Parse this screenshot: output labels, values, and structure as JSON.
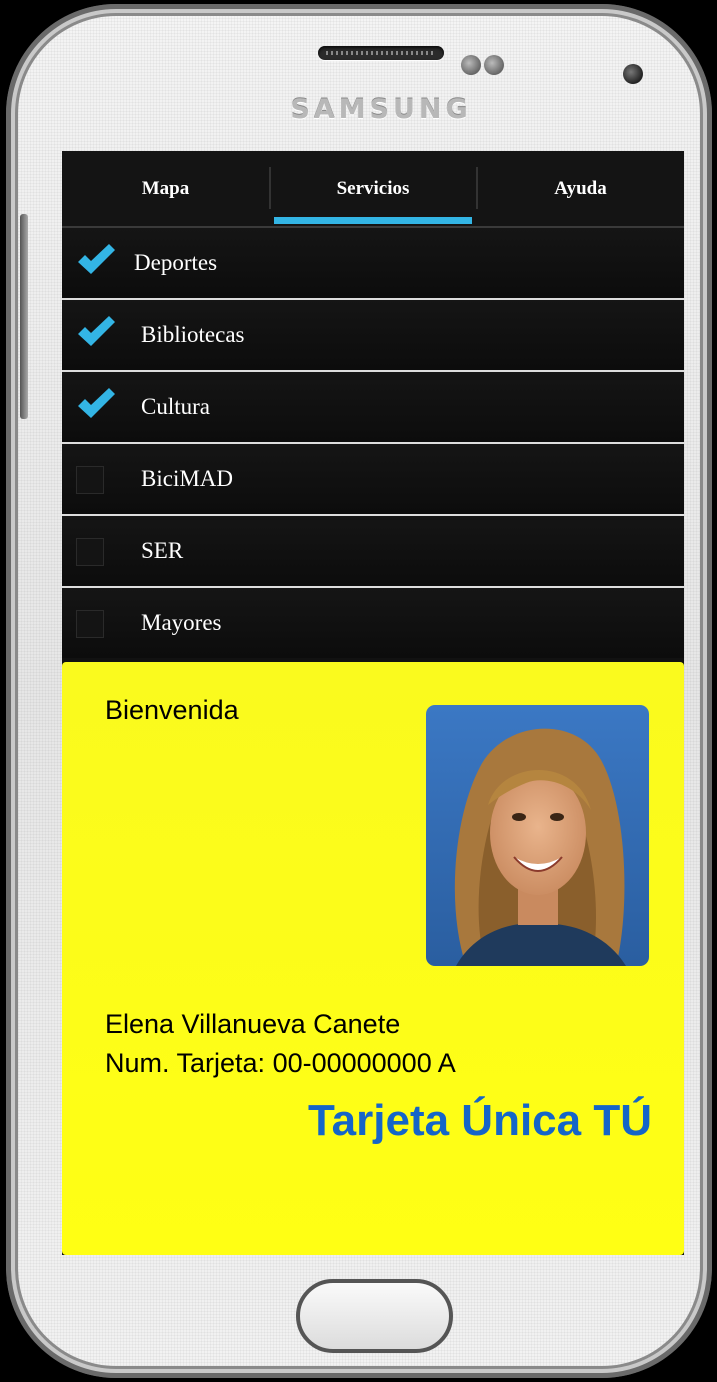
{
  "device": {
    "brand": "SAMSUNG"
  },
  "tabs": [
    {
      "label": "Mapa",
      "selected": false
    },
    {
      "label": "Servicios",
      "selected": true
    },
    {
      "label": "Ayuda",
      "selected": false
    }
  ],
  "accent_color": "#33b5e5",
  "services": [
    {
      "label": "Deportes",
      "checked": true
    },
    {
      "label": "Bibliotecas",
      "checked": true
    },
    {
      "label": "Cultura",
      "checked": true
    },
    {
      "label": "BiciMAD",
      "checked": false
    },
    {
      "label": "SER",
      "checked": false
    },
    {
      "label": "Mayores",
      "checked": false
    }
  ],
  "card": {
    "greeting": "Bienvenida",
    "name": "Elena Villanueva Canete",
    "card_number": "Num. Tarjeta: 00-00000000 A",
    "brand": "Tarjeta Única TÚ",
    "background_color": "#ffff14",
    "brand_color": "#1565c8",
    "photo_icon": "user-photo"
  }
}
